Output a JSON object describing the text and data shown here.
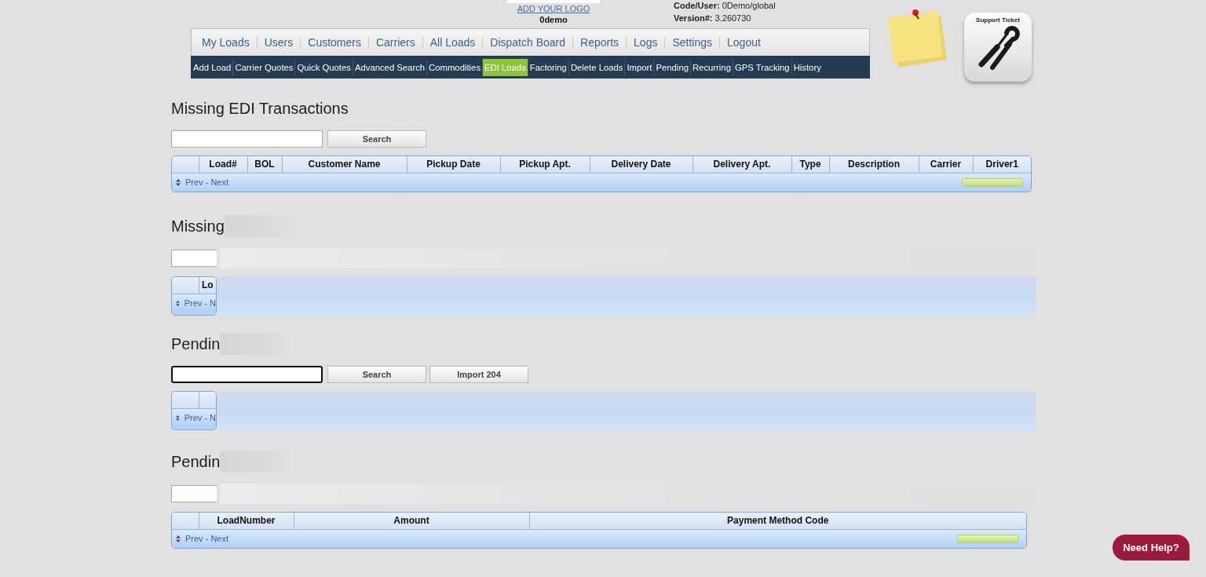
{
  "header": {
    "logo_link": "ADD YOUR LOGO",
    "company": "0demo",
    "code_user_label": "Code/User:",
    "code_user": "0Demo/global",
    "version_label": "Version#:",
    "version": "3.260730"
  },
  "main_nav": [
    {
      "label": "My Loads",
      "selected": false
    },
    {
      "label": "Users",
      "selected": false
    },
    {
      "label": "Customers",
      "selected": false
    },
    {
      "label": "Carriers",
      "selected": false
    },
    {
      "label": "All Loads",
      "selected": false
    },
    {
      "label": "Dispatch Board",
      "selected": false
    },
    {
      "label": "Reports",
      "selected": false
    },
    {
      "label": "Logs",
      "selected": false
    },
    {
      "label": "Settings",
      "selected": false
    },
    {
      "label": "Logout",
      "selected": false
    }
  ],
  "sub_nav": [
    {
      "label": "Add Load",
      "selected": false
    },
    {
      "label": "Carrier Quotes",
      "selected": false
    },
    {
      "label": "Quick Quotes",
      "selected": false
    },
    {
      "label": "Advanced Search",
      "selected": false
    },
    {
      "label": "Commodities",
      "selected": false
    },
    {
      "label": "EDI Loads",
      "selected": true
    },
    {
      "label": "Factoring",
      "selected": false
    },
    {
      "label": "Delete Loads",
      "selected": false
    },
    {
      "label": "Import",
      "selected": false
    },
    {
      "label": "Pending",
      "selected": false
    },
    {
      "label": "Recurring",
      "selected": false
    },
    {
      "label": "GPS Tracking",
      "selected": false
    },
    {
      "label": "History",
      "selected": false
    }
  ],
  "support_ticket": {
    "label": "Support Ticket"
  },
  "sections": [
    {
      "title": "Missing EDI Transactions",
      "title_obscured": false,
      "toolbar_obscured": false,
      "table_obscured": false,
      "search_focused": false,
      "buttons": [
        "Search"
      ],
      "columns": [
        "Load#",
        "BOL",
        "Customer Name",
        "Pickup Date",
        "Pickup Apt.",
        "Delivery Date",
        "Delivery Apt.",
        "Type",
        "Description",
        "Carrier",
        "Driver1"
      ],
      "pager": "Prev - Next"
    },
    {
      "title": "Missing",
      "title_obscured": true,
      "toolbar_obscured": true,
      "table_obscured": true,
      "search_focused": false,
      "columns": [
        "Lo"
      ],
      "pager": "Prev - N"
    },
    {
      "title": "Pendin",
      "title_obscured": true,
      "toolbar_obscured": false,
      "table_obscured": true,
      "search_focused": true,
      "buttons": [
        "Search",
        "Import 204"
      ],
      "pager": "Prev - N"
    },
    {
      "title": "Pendin",
      "title_obscured": true,
      "toolbar_obscured": true,
      "table_obscured": false,
      "search_focused": false,
      "columns": [
        "LoadNumber",
        "Amount",
        "Payment Method Code"
      ],
      "pager": "Prev - Next"
    }
  ],
  "help_button": "Need Help?"
}
